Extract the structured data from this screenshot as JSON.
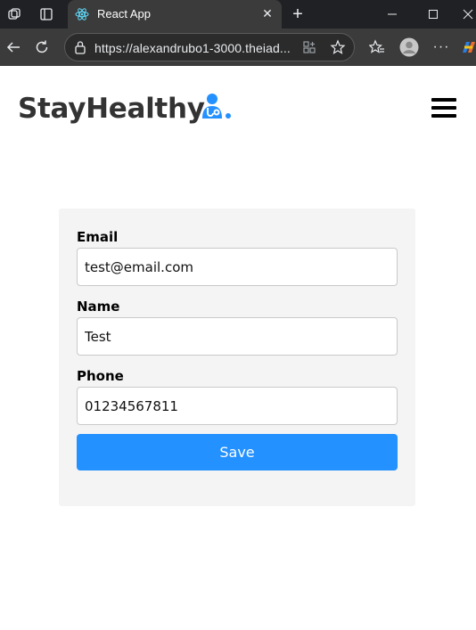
{
  "browser": {
    "tab_title": "React App",
    "url": "https://alexandrubo1-3000.theiad..."
  },
  "navbar": {
    "brand": "StayHealthy"
  },
  "form": {
    "email_label": "Email",
    "email_value": "test@email.com",
    "name_label": "Name",
    "name_value": "Test",
    "phone_label": "Phone",
    "phone_value": "01234567811",
    "save_label": "Save"
  },
  "colors": {
    "accent": "#2391ff",
    "card_bg": "#f4f4f4",
    "chrome_dark": "#202124"
  }
}
